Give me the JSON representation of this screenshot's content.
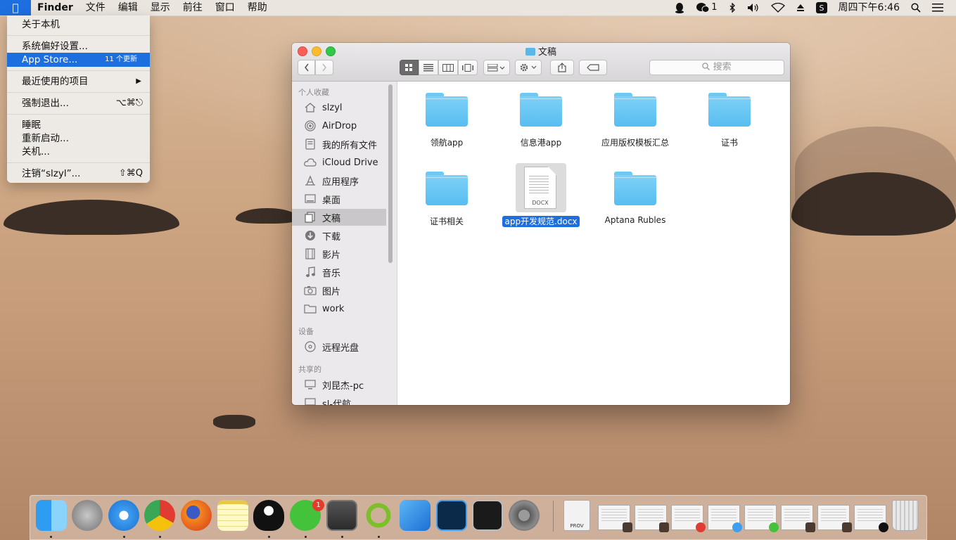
{
  "menubar": {
    "app": "Finder",
    "menus": [
      "文件",
      "编辑",
      "显示",
      "前往",
      "窗口",
      "帮助"
    ],
    "qq_notification": "",
    "wechat_count": "1",
    "clock": "周四下午6:46"
  },
  "apple_menu": {
    "about": "关于本机",
    "prefs": "系统偏好设置...",
    "app_store": "App Store...",
    "app_store_badge": "11 个更新",
    "recent": "最近使用的项目",
    "force_quit": "强制退出...",
    "force_quit_shortcut": "⌥⌘⎋",
    "sleep": "睡眠",
    "restart": "重新启动...",
    "shutdown": "关机...",
    "logout": "注销“slzyl”...",
    "logout_shortcut": "⇧⌘Q"
  },
  "finder": {
    "title": "文稿",
    "search_placeholder": "搜索",
    "sidebar": {
      "favorites_header": "个人收藏",
      "favorites": [
        "slzyl",
        "AirDrop",
        "我的所有文件",
        "iCloud Drive",
        "应用程序",
        "桌面",
        "文稿",
        "下载",
        "影片",
        "音乐",
        "图片",
        "work"
      ],
      "devices_header": "设备",
      "devices": [
        "远程光盘"
      ],
      "shared_header": "共享的",
      "shared": [
        "刘昆杰-pc",
        "sl-代航"
      ]
    },
    "files": [
      "领航app",
      "信息港app",
      "应用版权模板汇总",
      "证书",
      "证书相关",
      "app开发规范.docx",
      "Aptana Rubles"
    ],
    "doc_type": "DOCX"
  },
  "dock": {
    "wechat_badge": "1",
    "prov_label": "PROV"
  },
  "colors": {
    "accent": "#1d6fe0",
    "folder": "#5ab7ea",
    "close": "#fc5f57",
    "minimize": "#fdbc2e",
    "zoom": "#33c748"
  }
}
